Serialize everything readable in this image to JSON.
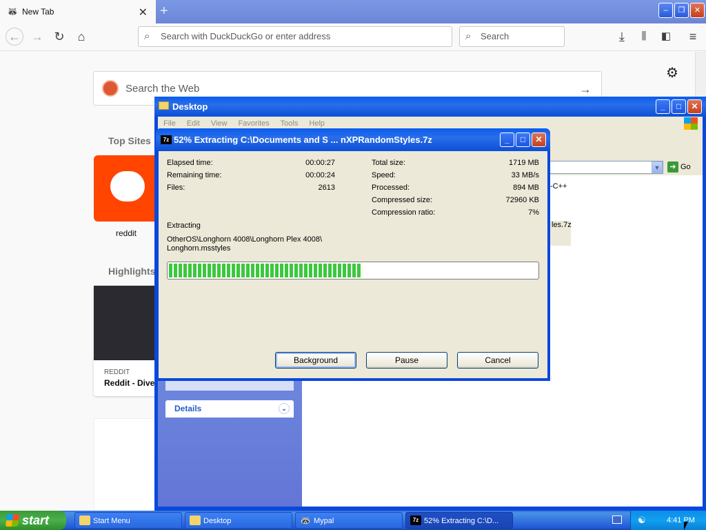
{
  "browser": {
    "tab_label": "New Tab",
    "url_placeholder": "Search with DuckDuckGo or enter address",
    "search_placeholder": "Search"
  },
  "newtab": {
    "search_placeholder": "Search the Web",
    "top_sites_heading": "Top Sites",
    "top_site_label": "reddit",
    "highlights_heading": "Highlights",
    "highlight_source": "REDDIT",
    "highlight_title": "Reddit - Dive"
  },
  "explorer": {
    "title": "Desktop",
    "menu": [
      "File",
      "Edit",
      "View",
      "Favorites",
      "Tools",
      "Help"
    ],
    "go_label": "Go",
    "details_label": "Details",
    "file_fragment_1": "-C++",
    "file_fragment_2": "les.7z"
  },
  "dialog": {
    "title": "52% Extracting C:\\Documents and S ... nXPRandomStyles.7z",
    "app_icon_text": "7z",
    "progress_percent": 52,
    "left": [
      {
        "label": "Elapsed time:",
        "value": "00:00:27"
      },
      {
        "label": "Remaining time:",
        "value": "00:00:24"
      },
      {
        "label": "Files:",
        "value": "2613"
      }
    ],
    "right": [
      {
        "label": "Total size:",
        "value": "1719 MB"
      },
      {
        "label": "Speed:",
        "value": "33 MB/s"
      },
      {
        "label": "Processed:",
        "value": "894 MB"
      },
      {
        "label": "Compressed size:",
        "value": "72960 KB"
      },
      {
        "label": "Compression ratio:",
        "value": "7%"
      }
    ],
    "status_label": "Extracting",
    "current_path_1": "OtherOS\\Longhorn 4008\\Longhorn Plex 4008\\",
    "current_path_2": "Longhorn.msstyles",
    "buttons": [
      "Background",
      "Pause",
      "Cancel"
    ]
  },
  "taskbar": {
    "start_label": "start",
    "items": [
      "Start Menu",
      "Desktop",
      "Mypal",
      "52% Extracting C:\\D..."
    ],
    "clock": "4:41 PM"
  }
}
